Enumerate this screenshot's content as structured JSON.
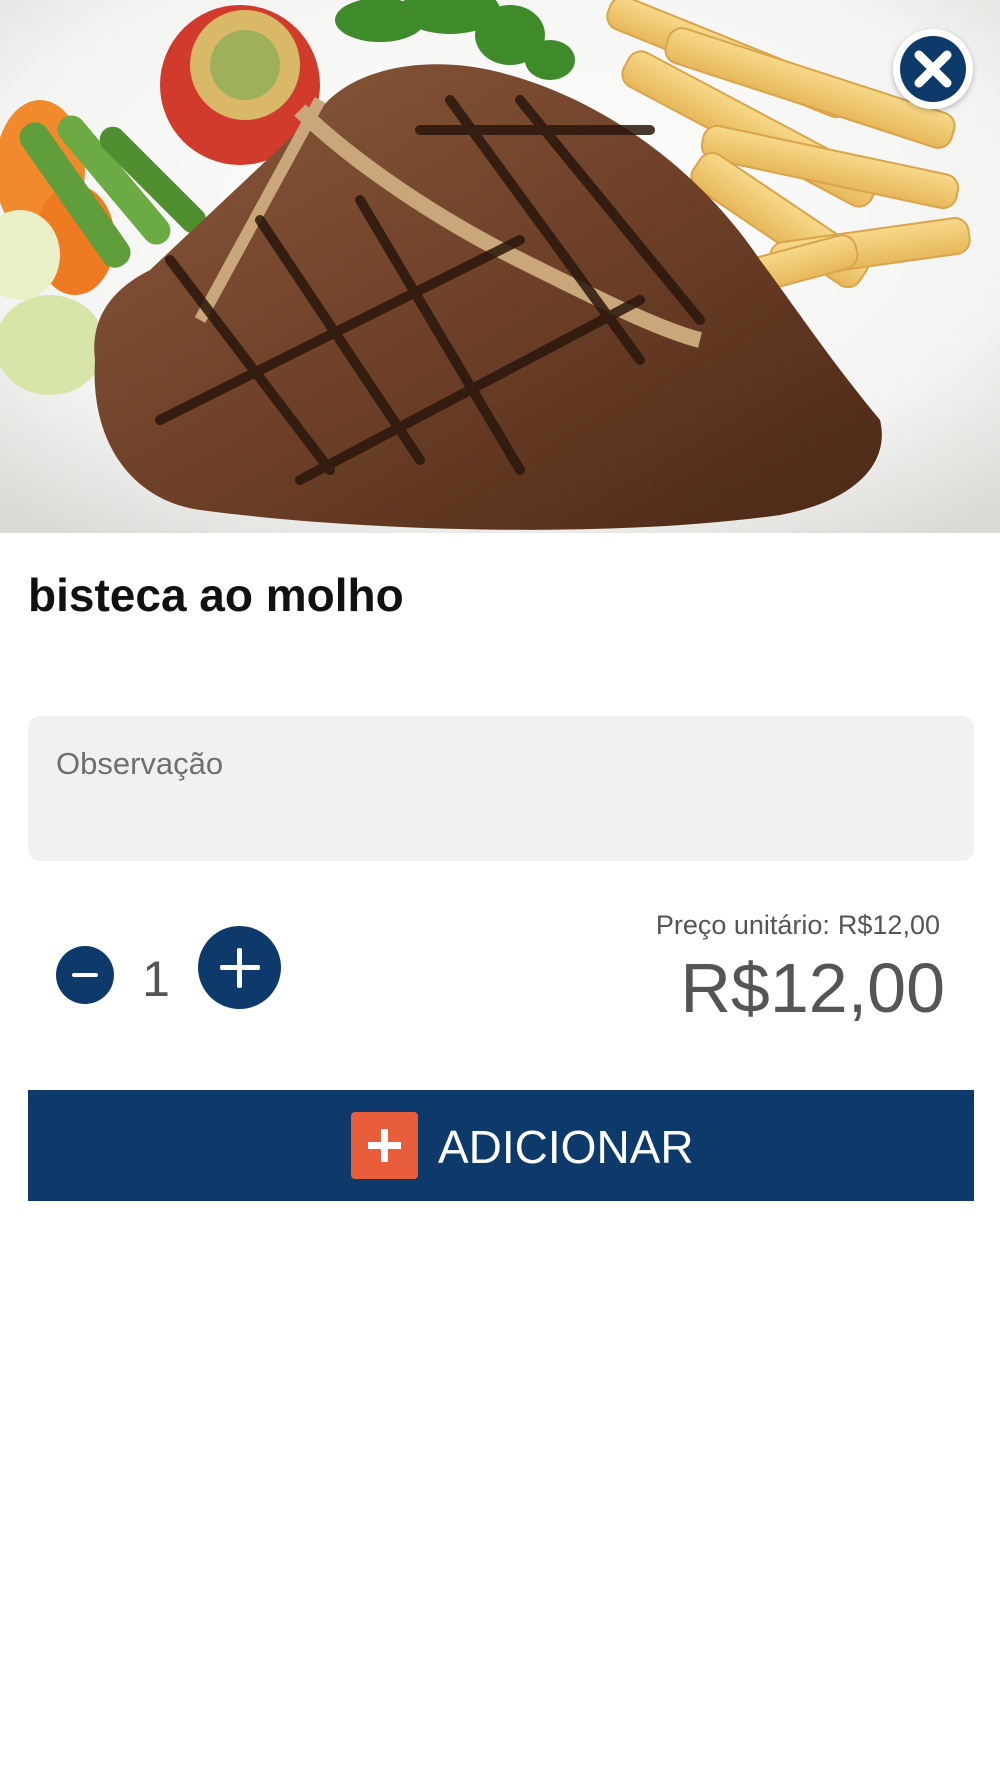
{
  "product": {
    "image_alt": "bisteca ao molho",
    "name": "bisteca ao molho"
  },
  "observation": {
    "placeholder": "Observação",
    "value": ""
  },
  "quantity": {
    "value": "1"
  },
  "price": {
    "unit_label": "Preço unitário:",
    "unit_value": "R$12,00",
    "total": "R$12,00"
  },
  "actions": {
    "add_label": "ADICIONAR",
    "close_icon": "close-icon",
    "minus_icon": "minus-icon",
    "plus_icon": "plus-icon",
    "add_icon": "plus-square-icon"
  },
  "colors": {
    "primary": "#0d3a6b",
    "accent": "#e85d3a",
    "input_bg": "#f0f1f3"
  }
}
